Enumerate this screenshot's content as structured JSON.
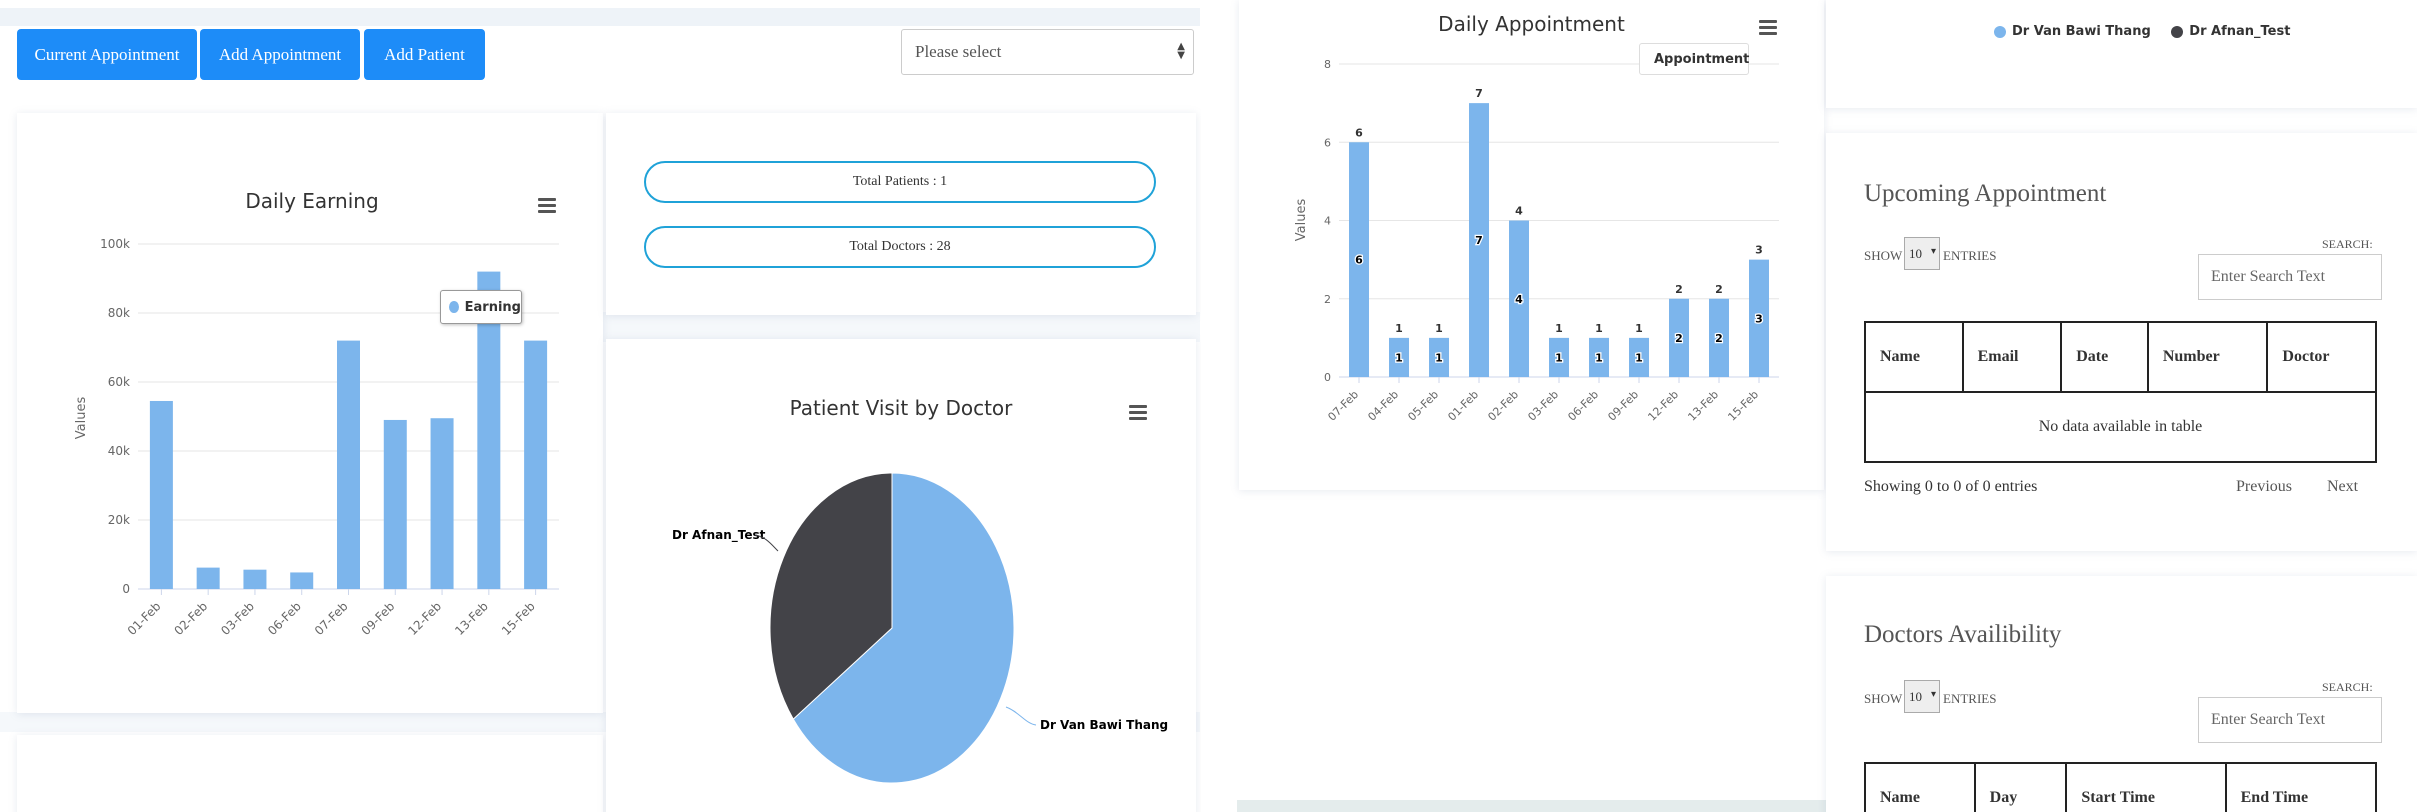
{
  "toolbar": {
    "current_appointment": "Current Appointment",
    "add_appointment": "Add Appointment",
    "add_patient": "Add Patient",
    "select_placeholder": "Please select"
  },
  "stats": {
    "total_patients": "Total Patients : 1",
    "total_doctors": "Total Doctors : 28"
  },
  "colors": {
    "accent": "#1d8cf8",
    "bar": "#7cb5ec",
    "dark_slice": "#434348",
    "pill_border": "#1fa2d8"
  },
  "earning_chart": {
    "title": "Daily Earning",
    "ylabel": "Values",
    "legend": "Earning",
    "y_ticks": [
      "0",
      "20k",
      "40k",
      "60k",
      "80k",
      "100k"
    ]
  },
  "appointment_chart": {
    "title": "Daily Appointment",
    "ylabel": "Values",
    "legend": "Appointment",
    "y_ticks": [
      "0",
      "2",
      "4",
      "6",
      "8"
    ]
  },
  "pie_chart": {
    "title": "Patient Visit by Doctor",
    "legend_doctor_1": "Dr Van Bawi Thang",
    "legend_doctor_2": "Dr Afnan_Test"
  },
  "chart_data": [
    {
      "type": "bar",
      "title": "Daily Earning",
      "categories": [
        "01-Feb",
        "02-Feb",
        "03-Feb",
        "06-Feb",
        "07-Feb",
        "09-Feb",
        "12-Feb",
        "13-Feb",
        "15-Feb"
      ],
      "series": [
        {
          "name": "Earning",
          "values": [
            54500,
            6200,
            5600,
            4800,
            72000,
            49000,
            49500,
            92000,
            72000
          ]
        }
      ],
      "xlabel": "",
      "ylabel": "Values",
      "ylim": [
        0,
        100000
      ],
      "grid": true,
      "legend": "top-right"
    },
    {
      "type": "bar",
      "title": "Daily Appointment",
      "categories": [
        "07-Feb",
        "04-Feb",
        "05-Feb",
        "01-Feb",
        "02-Feb",
        "03-Feb",
        "06-Feb",
        "09-Feb",
        "12-Feb",
        "13-Feb",
        "15-Feb"
      ],
      "series": [
        {
          "name": "Appointment",
          "values": [
            6,
            1,
            1,
            7,
            4,
            1,
            1,
            1,
            2,
            2,
            3
          ]
        }
      ],
      "xlabel": "",
      "ylabel": "Values",
      "ylim": [
        0,
        8
      ],
      "grid": true,
      "legend": "top-right"
    },
    {
      "type": "pie",
      "title": "Patient Visit by Doctor",
      "labels": [
        "Dr Van Bawi Thang",
        "Dr Afnan_Test"
      ],
      "values": [
        65,
        35
      ]
    }
  ],
  "upcoming": {
    "title": "Upcoming Appointment",
    "show": "SHOW",
    "entries_value": "10",
    "entries": "ENTRIES",
    "search_label": "SEARCH:",
    "search_placeholder": "Enter Search Text",
    "columns": [
      "Name",
      "Email",
      "Date",
      "Number",
      "Doctor"
    ],
    "empty": "No data available in table",
    "info": "Showing 0 to 0 of 0 entries",
    "previous": "Previous",
    "next": "Next"
  },
  "availability": {
    "title": "Doctors Availibility",
    "show": "SHOW",
    "entries_value": "10",
    "entries": "ENTRIES",
    "search_label": "SEARCH:",
    "search_placeholder": "Enter Search Text",
    "columns": [
      "Name",
      "Day",
      "Start Time",
      "End Time"
    ]
  }
}
